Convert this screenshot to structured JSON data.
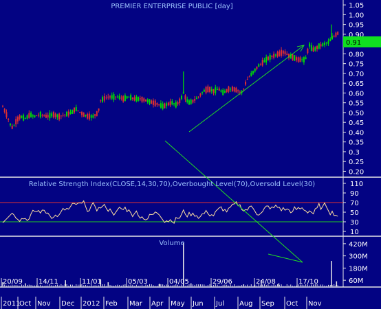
{
  "colors": {
    "background": "#030383",
    "grid": "#1a1ab0",
    "separator": "#e8e8e8",
    "up_candle": "#00e000",
    "down_candle": "#e03030",
    "rsi_line": "#ffe0a0",
    "overbought_line": "#e03030",
    "oversold_line": "#22cc22",
    "annotation_line": "#22dd22",
    "volume_bar": "#e8e8e8",
    "last_price_bg": "#10e020",
    "text": "#ffffff",
    "title_text": "#9ec4ff"
  },
  "chart_data": [
    {
      "type": "candlestick",
      "title": "PREMIER ENTERPRISE PUBLIC [day]",
      "last_price_label": "0.91",
      "y_ticks": [
        "1.05",
        "1.00",
        "0.95",
        "0.90",
        "0.85",
        "0.80",
        "0.75",
        "0.70",
        "0.65",
        "0.60",
        "0.55",
        "0.50",
        "0.45",
        "0.40",
        "0.35",
        "0.3",
        "0.25",
        "0.20"
      ],
      "y_tick_values": [
        1.05,
        1.0,
        0.95,
        0.9,
        0.85,
        0.8,
        0.75,
        0.7,
        0.65,
        0.6,
        0.55,
        0.5,
        0.45,
        0.4,
        0.35,
        0.3,
        0.25,
        0.2
      ],
      "ylim": [
        0.17,
        1.075
      ],
      "close_path": [
        [
          0,
          0.53
        ],
        [
          3,
          0.49
        ],
        [
          6,
          0.44
        ],
        [
          8,
          0.42
        ],
        [
          11,
          0.46
        ],
        [
          14,
          0.48
        ],
        [
          18,
          0.47
        ],
        [
          22,
          0.49
        ],
        [
          25,
          0.48
        ],
        [
          30,
          0.49
        ],
        [
          35,
          0.48
        ],
        [
          40,
          0.49
        ],
        [
          45,
          0.48
        ],
        [
          50,
          0.49
        ],
        [
          55,
          0.5
        ],
        [
          58,
          0.52
        ],
        [
          60,
          0.51
        ],
        [
          64,
          0.49
        ],
        [
          68,
          0.48
        ],
        [
          72,
          0.48
        ],
        [
          76,
          0.5
        ],
        [
          78,
          0.56
        ],
        [
          80,
          0.57
        ],
        [
          84,
          0.58
        ],
        [
          88,
          0.58
        ],
        [
          92,
          0.58
        ],
        [
          96,
          0.57
        ],
        [
          100,
          0.58
        ],
        [
          105,
          0.57
        ],
        [
          110,
          0.57
        ],
        [
          115,
          0.56
        ],
        [
          120,
          0.55
        ],
        [
          125,
          0.54
        ],
        [
          128,
          0.53
        ],
        [
          130,
          0.54
        ],
        [
          135,
          0.55
        ],
        [
          138,
          0.54
        ],
        [
          140,
          0.55
        ],
        [
          142,
          0.57
        ],
        [
          144,
          0.6
        ],
        [
          146,
          0.57
        ],
        [
          148,
          0.55
        ],
        [
          152,
          0.56
        ],
        [
          156,
          0.58
        ],
        [
          160,
          0.61
        ],
        [
          164,
          0.62
        ],
        [
          168,
          0.61
        ],
        [
          172,
          0.62
        ],
        [
          176,
          0.6
        ],
        [
          180,
          0.62
        ],
        [
          184,
          0.62
        ],
        [
          188,
          0.61
        ],
        [
          190,
          0.6
        ],
        [
          192,
          0.62
        ],
        [
          194,
          0.66
        ],
        [
          196,
          0.68
        ],
        [
          200,
          0.71
        ],
        [
          204,
          0.74
        ],
        [
          208,
          0.76
        ],
        [
          212,
          0.78
        ],
        [
          216,
          0.79
        ],
        [
          220,
          0.8
        ],
        [
          224,
          0.81
        ],
        [
          228,
          0.79
        ],
        [
          232,
          0.78
        ],
        [
          236,
          0.77
        ],
        [
          240,
          0.77
        ],
        [
          242,
          0.78
        ],
        [
          244,
          0.85
        ],
        [
          246,
          0.83
        ],
        [
          248,
          0.82
        ],
        [
          252,
          0.84
        ],
        [
          256,
          0.85
        ],
        [
          260,
          0.86
        ],
        [
          262,
          0.88
        ],
        [
          264,
          0.89
        ],
        [
          266,
          0.9
        ],
        [
          268,
          0.91
        ]
      ],
      "x_dates_top": [
        "20/09",
        "14/11",
        "11/01",
        "05/03",
        "04/05",
        "29/06",
        "24/08",
        "17/10"
      ],
      "x_months_bottom": [
        "2011",
        "Oct",
        "Nov",
        "Dec",
        "2012",
        "Feb",
        "Mar",
        "Apr",
        "May",
        "Jun",
        "Jul",
        "Aug",
        "Sep",
        "Oct",
        "Nov"
      ]
    },
    {
      "type": "line",
      "title": "Relative Strength Index(CLOSE,14,30,70),Overbought Level(70),Oversold Level(30)",
      "y_ticks": [
        "110",
        "90",
        "70",
        "50",
        "30",
        "10"
      ],
      "y_tick_values": [
        110,
        90,
        70,
        50,
        30,
        10
      ],
      "ylim": [
        0,
        120
      ],
      "overbought": 70,
      "oversold": 30
    },
    {
      "type": "bar",
      "title": "Volume",
      "y_ticks": [
        "420M",
        "300M",
        "180M",
        "60M"
      ],
      "y_tick_values": [
        420,
        300,
        180,
        60
      ],
      "ylim": [
        0,
        480
      ],
      "spikes": [
        [
          0,
          40
        ],
        [
          18,
          30
        ],
        [
          50,
          60
        ],
        [
          78,
          70
        ],
        [
          84,
          40
        ],
        [
          125,
          25
        ],
        [
          144,
          430
        ],
        [
          150,
          30
        ],
        [
          192,
          20
        ],
        [
          206,
          60
        ],
        [
          220,
          30
        ],
        [
          262,
          250
        ],
        [
          266,
          50
        ]
      ]
    }
  ]
}
